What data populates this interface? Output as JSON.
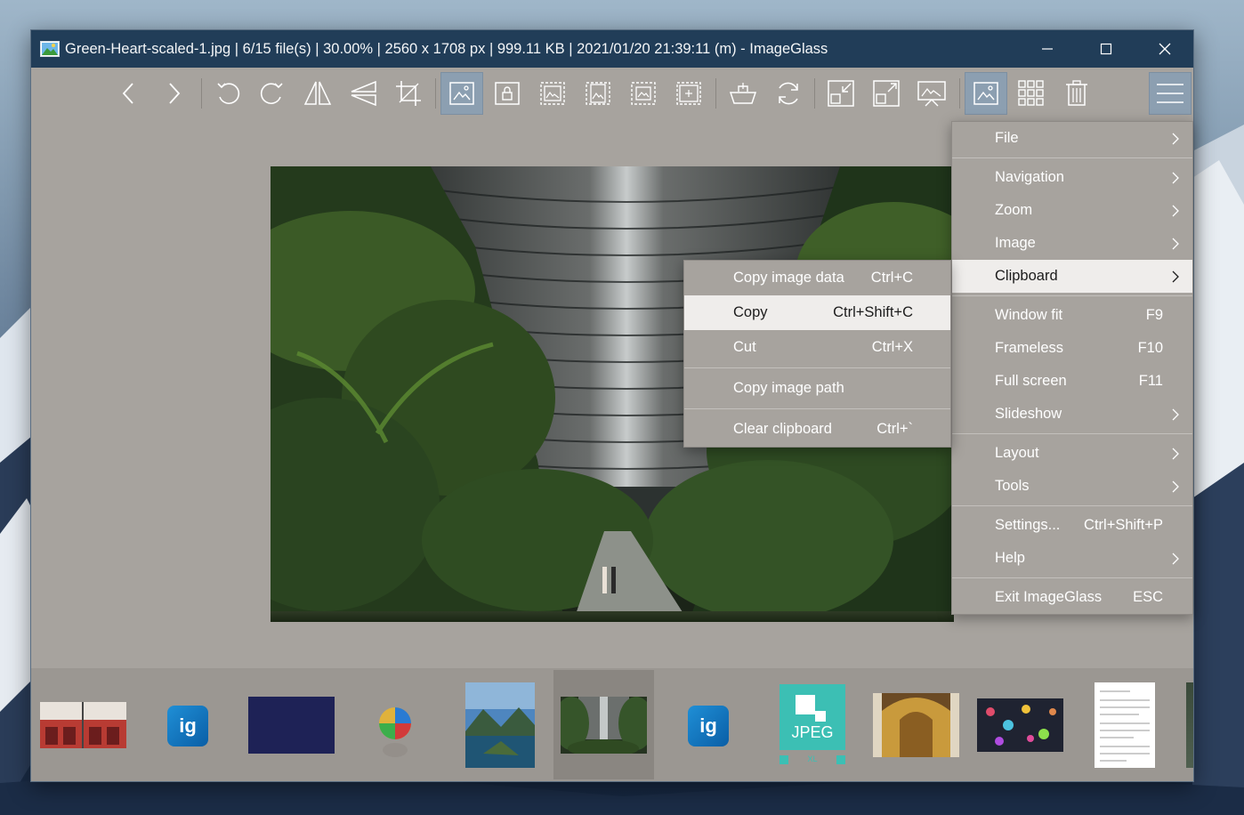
{
  "window": {
    "title": "Green-Heart-scaled-1.jpg  |  6/15 file(s)  |  30.00%  |  2560 x 1708 px  |  999.11 KB  |  2021/01/20 21:39:11 (m)  - ImageGlass"
  },
  "toolbar": {
    "buttons": [
      {
        "name": "previous-image",
        "icon": "chevron-left-icon",
        "active": false
      },
      {
        "name": "next-image",
        "icon": "chevron-right-icon",
        "active": false
      },
      {
        "name": "rotate-left",
        "icon": "rotate-left-icon",
        "active": false
      },
      {
        "name": "rotate-right",
        "icon": "rotate-right-icon",
        "active": false
      },
      {
        "name": "flip-horizontal",
        "icon": "flip-horizontal-icon",
        "active": false
      },
      {
        "name": "flip-vertical",
        "icon": "flip-vertical-icon",
        "active": false
      },
      {
        "name": "crop",
        "icon": "crop-icon",
        "active": false
      },
      {
        "name": "auto-zoom",
        "icon": "auto-zoom-icon",
        "active": true
      },
      {
        "name": "lock-zoom",
        "icon": "lock-zoom-icon",
        "active": false
      },
      {
        "name": "scale-to-width",
        "icon": "scale-width-icon",
        "active": false
      },
      {
        "name": "scale-to-height",
        "icon": "scale-height-icon",
        "active": false
      },
      {
        "name": "scale-to-fit",
        "icon": "scale-fit-icon",
        "active": false
      },
      {
        "name": "scale-to-fill",
        "icon": "scale-fill-icon",
        "active": false
      },
      {
        "name": "open-with",
        "icon": "open-with-icon",
        "active": false
      },
      {
        "name": "refresh",
        "icon": "refresh-icon",
        "active": false
      },
      {
        "name": "window-fit",
        "icon": "window-fit-icon",
        "active": false
      },
      {
        "name": "full-screen",
        "icon": "full-screen-icon",
        "active": false
      },
      {
        "name": "slideshow",
        "icon": "slideshow-icon",
        "active": false
      },
      {
        "name": "thumbnail-bar",
        "icon": "thumbnail-bar-icon",
        "active": true
      },
      {
        "name": "checkerboard",
        "icon": "grid-icon",
        "active": false
      },
      {
        "name": "delete",
        "icon": "trash-icon",
        "active": false
      },
      {
        "name": "main-menu",
        "icon": "hamburger-menu-icon",
        "active": true
      }
    ]
  },
  "main_menu": {
    "items": [
      {
        "label": "File",
        "shortcut": "",
        "submenu": true,
        "highlight": false
      },
      {
        "sep": true
      },
      {
        "label": "Navigation",
        "shortcut": "",
        "submenu": true,
        "highlight": false
      },
      {
        "label": "Zoom",
        "shortcut": "",
        "submenu": true,
        "highlight": false
      },
      {
        "label": "Image",
        "shortcut": "",
        "submenu": true,
        "highlight": false
      },
      {
        "label": "Clipboard",
        "shortcut": "",
        "submenu": true,
        "highlight": true
      },
      {
        "sep": true
      },
      {
        "label": "Window fit",
        "shortcut": "F9",
        "submenu": false,
        "highlight": false
      },
      {
        "label": "Frameless",
        "shortcut": "F10",
        "submenu": false,
        "highlight": false
      },
      {
        "label": "Full screen",
        "shortcut": "F11",
        "submenu": false,
        "highlight": false
      },
      {
        "label": "Slideshow",
        "shortcut": "",
        "submenu": true,
        "highlight": false
      },
      {
        "sep": true
      },
      {
        "label": "Layout",
        "shortcut": "",
        "submenu": true,
        "highlight": false
      },
      {
        "label": "Tools",
        "shortcut": "",
        "submenu": true,
        "highlight": false
      },
      {
        "sep": true
      },
      {
        "label": "Settings...",
        "shortcut": "Ctrl+Shift+P",
        "submenu": false,
        "highlight": false
      },
      {
        "label": "Help",
        "shortcut": "",
        "submenu": true,
        "highlight": false
      },
      {
        "sep": true
      },
      {
        "label": "Exit ImageGlass",
        "shortcut": "ESC",
        "submenu": false,
        "highlight": false
      }
    ]
  },
  "clipboard_menu": {
    "items": [
      {
        "label": "Copy image data",
        "shortcut": "Ctrl+C",
        "highlight": false
      },
      {
        "label": "Copy",
        "shortcut": "Ctrl+Shift+C",
        "highlight": true
      },
      {
        "label": "Cut",
        "shortcut": "Ctrl+X",
        "highlight": false
      },
      {
        "sep": true
      },
      {
        "label": "Copy image path",
        "shortcut": "",
        "highlight": false
      },
      {
        "sep": true
      },
      {
        "label": "Clear clipboard",
        "shortcut": "Ctrl+`",
        "highlight": false
      }
    ]
  },
  "thumbnails": {
    "items": [
      {
        "name": "thumb-storefront",
        "selected": false
      },
      {
        "name": "thumb-ig-logo-1",
        "label": "ig",
        "selected": false
      },
      {
        "name": "thumb-dark-blue",
        "selected": false
      },
      {
        "name": "thumb-ball",
        "selected": false
      },
      {
        "name": "thumb-lake-landscape",
        "selected": false
      },
      {
        "name": "thumb-green-heart",
        "selected": true
      },
      {
        "name": "thumb-ig-logo-2",
        "label": "ig",
        "selected": false
      },
      {
        "name": "thumb-jpeg-xl",
        "label": "JPEG",
        "sublabel": "XL",
        "selected": false
      },
      {
        "name": "thumb-cathedral",
        "selected": false
      },
      {
        "name": "thumb-colorful-pattern",
        "selected": false
      },
      {
        "name": "thumb-document",
        "selected": false
      }
    ]
  },
  "colors": {
    "titlebar": "#213d58",
    "window_bg": "#a7a39e",
    "menu_highlight": "#efedeb",
    "active_button": "#8c9fb1"
  }
}
